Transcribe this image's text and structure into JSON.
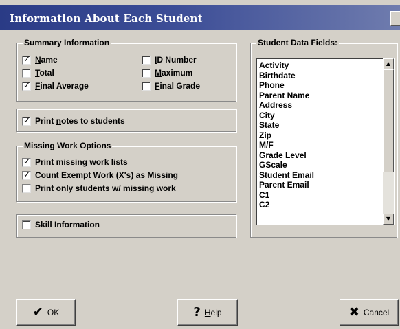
{
  "window": {
    "title": "Information About Each Student"
  },
  "summary": {
    "title": "Summary Information",
    "items": [
      {
        "label_ul": "N",
        "label_rest": "ame",
        "checked": true
      },
      {
        "label_ul": "T",
        "label_rest": "otal",
        "checked": false
      },
      {
        "label_ul": "F",
        "label_rest": "inal Average",
        "checked": true
      },
      {
        "label_ul": "I",
        "label_rest": "D Number",
        "checked": false
      },
      {
        "label_ul": "M",
        "label_rest": "aximum",
        "checked": false
      },
      {
        "label_ul": "F",
        "label_rest": "inal Grade",
        "checked": false
      }
    ]
  },
  "print_notes": {
    "before": "Print ",
    "ul": "n",
    "after": "otes to students",
    "checked": true
  },
  "missing": {
    "title": "Missing Work Options",
    "items": [
      {
        "ul": "P",
        "rest": "rint missing work lists",
        "checked": true
      },
      {
        "ul": "C",
        "rest": "ount Exempt Work (X's) as Missing",
        "checked": true
      },
      {
        "ul": "P",
        "rest": "rint only students w/ missing work",
        "checked": false
      }
    ]
  },
  "skill": {
    "label": "Skill Information",
    "checked": false
  },
  "fields": {
    "title": "Student Data Fields:",
    "items": [
      "Activity",
      "Birthdate",
      "Phone",
      "Parent Name",
      "Address",
      "City",
      "State",
      "Zip",
      "M/F",
      "Grade Level",
      "GScale",
      "Student Email",
      "Parent Email",
      "C1",
      "C2"
    ]
  },
  "buttons": {
    "ok": "OK",
    "help_ul": "H",
    "help_rest": "elp",
    "cancel": "Cancel"
  },
  "icons": {
    "ok": "check-icon",
    "help": "question-icon",
    "cancel": "x-icon"
  }
}
